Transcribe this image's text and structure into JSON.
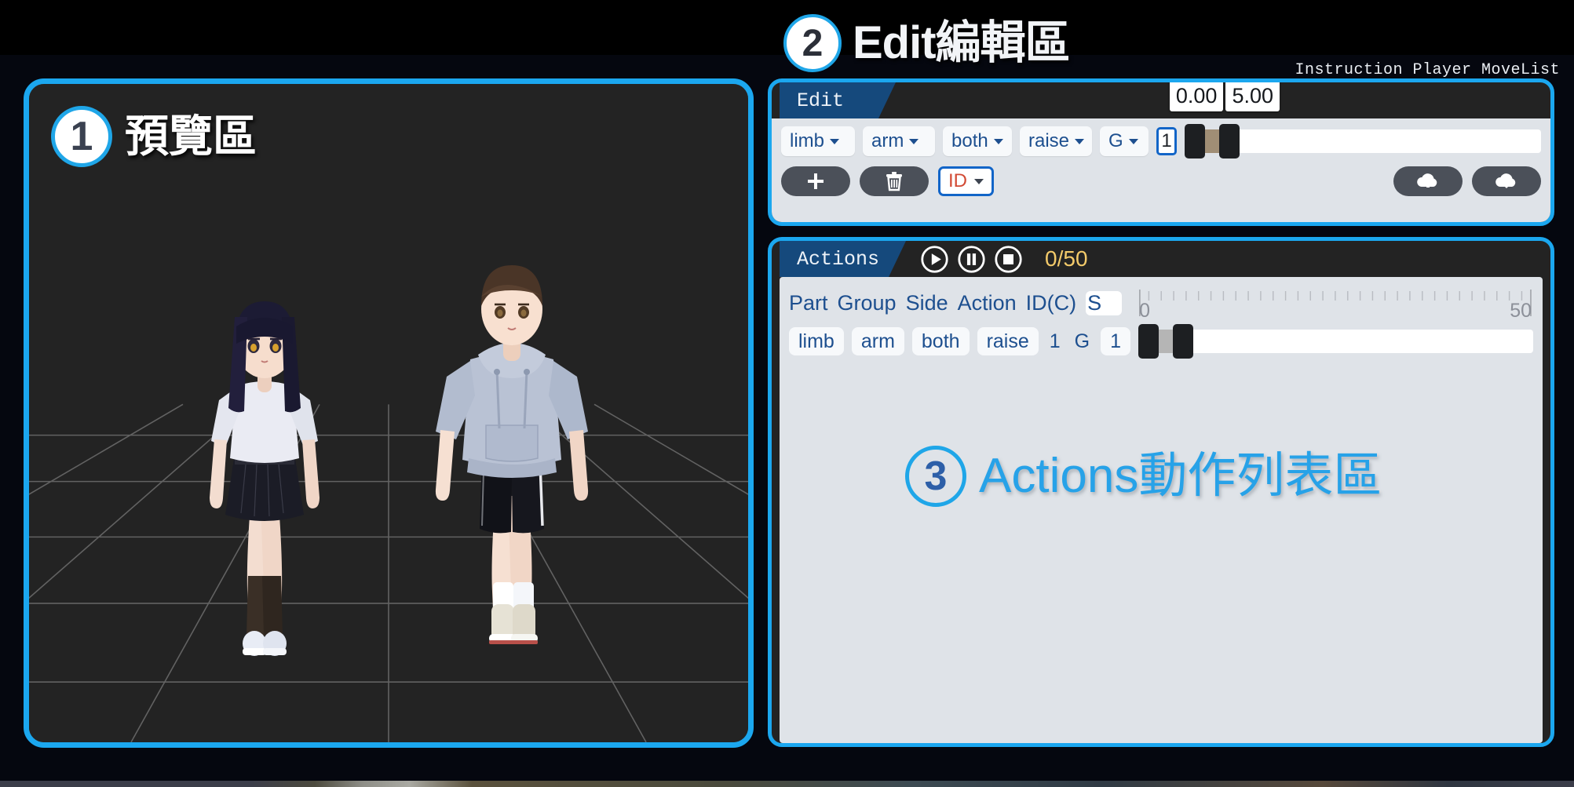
{
  "headings": {
    "preview": {
      "number": "1",
      "label": "預覽區"
    },
    "edit": {
      "number": "2",
      "label": "Edit編輯區"
    },
    "actions": {
      "number": "3",
      "label": "Actions動作列表區"
    }
  },
  "instruction_text": "Instruction Player MoveList",
  "edit_panel": {
    "tab_label": "Edit",
    "range_tooltips": {
      "min": "0.00",
      "max": "5.00"
    },
    "dropdowns": [
      {
        "name": "part",
        "value": "limb"
      },
      {
        "name": "group",
        "value": "arm"
      },
      {
        "name": "side",
        "value": "both"
      },
      {
        "name": "action",
        "value": "raise"
      },
      {
        "name": "letter-group",
        "value": "G"
      }
    ],
    "count_value": "1",
    "buttons": {
      "add": "add-icon",
      "delete": "trash-icon",
      "id_select": "ID",
      "cloud_upload": "cloud-upload-icon",
      "cloud_download": "cloud-download-icon"
    }
  },
  "actions_panel": {
    "tab_label": "Actions",
    "transport": [
      {
        "name": "play",
        "icon": "play-icon"
      },
      {
        "name": "pause",
        "icon": "pause-icon"
      },
      {
        "name": "stop",
        "icon": "stop-icon"
      }
    ],
    "counter": "0/50",
    "columns": [
      "Part",
      "Group",
      "Side",
      "Action",
      "ID(C)",
      "S"
    ],
    "ruler": {
      "min": "0",
      "max": "50"
    },
    "rows": [
      {
        "part": "limb",
        "group": "arm",
        "side": "both",
        "action": "raise",
        "id_c": "1",
        "g": "G",
        "s": "1"
      }
    ]
  },
  "preview_panel": {
    "characters": [
      {
        "name": "female-avatar",
        "hair": "#1c1b34",
        "top": "#e9eaf2",
        "bottom": "#1b1c26",
        "socks": "#3a2f26",
        "shoes": "#e8ecf5"
      },
      {
        "name": "male-avatar",
        "hair": "#4a3527",
        "top": "#b9c2d4",
        "bottom": "#111218",
        "socks": "#ffffff",
        "shoes": "#e6e2d5"
      }
    ],
    "floor": "perspective-grid"
  },
  "colors": {
    "accent_cyan": "#1ba7ef",
    "tab_blue": "#15497c",
    "panel_dark": "#232323",
    "panel_light": "#dfe3e8",
    "text_blue": "#1d4f8f",
    "counter_gold": "#f3ca6a",
    "title3_blue": "#27a2e8"
  }
}
